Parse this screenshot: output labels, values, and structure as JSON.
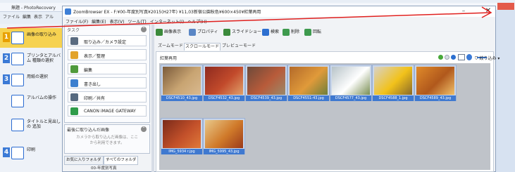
{
  "background_window": {
    "title": "無題 - PhotoRecovery",
    "menu": [
      "ファイル",
      "編集",
      "表示",
      "アル"
    ],
    "steps": [
      {
        "num": "1",
        "label": "画像の取り込み"
      },
      {
        "num": "2",
        "label": "プリンタとアルバム 種類の選択"
      },
      {
        "num": "3",
        "label": "用紙の選択"
      },
      {
        "num": "",
        "label": "アルバムの操作"
      },
      {
        "num": "",
        "label": "タイトルと見出しの 追加"
      },
      {
        "num": "4",
        "label": "印刷"
      }
    ]
  },
  "window": {
    "title": "ZoomBrowser EX - F:¥00-年度別写真¥2015(H27年) ¥11,03新宿公園秋色¥600×450¥紅葉再用",
    "minimize": "–",
    "close": "✕",
    "menu": [
      "ファイル(F)",
      "編集(E)",
      "表示(V)",
      "ツール(T)",
      "インターネット(I)",
      "ヘルプ(H)"
    ]
  },
  "task_panel": {
    "header": "タスク",
    "collapse": "⌃",
    "items": [
      {
        "label": "取り込み／カメラ設定",
        "icon": "camera-import-icon",
        "color": "#5a6b80"
      },
      {
        "label": "表示／整理",
        "icon": "view-organize-icon",
        "color": "#e2a32a"
      },
      {
        "label": "編集",
        "icon": "edit-icon",
        "color": "#4f9a3b"
      },
      {
        "label": "書き出し",
        "icon": "export-icon",
        "color": "#3c7fcf"
      },
      {
        "label": "印刷／共有",
        "icon": "print-share-icon",
        "color": "#56697f"
      },
      {
        "label": "CANON iMAGE GATEWAY",
        "icon": "canon-gateway-icon",
        "color": "#2f9c4a"
      }
    ]
  },
  "recent_panel": {
    "header": "最後に取り込んだ画像",
    "note": "カメラから取り込んだ画像は、ここから利用できます。"
  },
  "folder_tabs": [
    "お気に入りフォルダ",
    "すべてのフォルダ"
  ],
  "folder_row": "00-年度別写真",
  "toolbar": [
    {
      "label": "画像表示",
      "icon": "image-view-icon",
      "color": "#3b8a3b"
    },
    {
      "label": "プロパティ",
      "icon": "properties-icon",
      "color": "#5a86c5"
    },
    {
      "label": "スライドショー",
      "icon": "slideshow-icon",
      "color": "#3b8a3b"
    },
    {
      "label": "検索",
      "icon": "search-icon",
      "color": "#2d6fd0"
    },
    {
      "label": "削除",
      "icon": "delete-icon",
      "color": "#3e9a4e"
    },
    {
      "label": "回転",
      "icon": "rotate-icon",
      "color": "#3e9a4e"
    }
  ],
  "mode_tabs": [
    "ズームモード",
    "スクロールモード",
    "プレビューモード"
  ],
  "group_label": "紅葉再用",
  "filter_label": "絞り込み",
  "thumbnails": [
    {
      "caption": "DSCF4510_43.jpg",
      "colors": [
        "#7a5a3a",
        "#c8a472",
        "#d9b98f"
      ]
    },
    {
      "caption": "DSCF4532_43.jpg",
      "colors": [
        "#8e2a1f",
        "#c24a2b",
        "#e0a06a"
      ]
    },
    {
      "caption": "DSCF4539_43.jpg",
      "colors": [
        "#6d4a3a",
        "#b85b3a",
        "#9b8a6a"
      ]
    },
    {
      "caption": "DSCF4551-43.jpg",
      "colors": [
        "#b36a2a",
        "#e09a3a",
        "#6f7f3a"
      ]
    },
    {
      "caption": "DSCF4577_43.jpg",
      "colors": [
        "#b7c3c8",
        "#ffffff",
        "#7a8f54"
      ]
    },
    {
      "caption": "DSCF4588_1.jpg",
      "colors": [
        "#d8d2c8",
        "#f2c21a",
        "#8a6a2a"
      ]
    },
    {
      "caption": "DSCF4589_43.jpg",
      "colors": [
        "#e08a2a",
        "#b0581c",
        "#f0c06a"
      ]
    },
    {
      "caption": "IMG_5934 r.jpg",
      "colors": [
        "#7a2a1a",
        "#c2502a",
        "#e07a3a"
      ]
    },
    {
      "caption": "IMG_5995_43.jpg",
      "colors": [
        "#e8c88a",
        "#d07a2a",
        "#9a3a1a"
      ]
    }
  ]
}
